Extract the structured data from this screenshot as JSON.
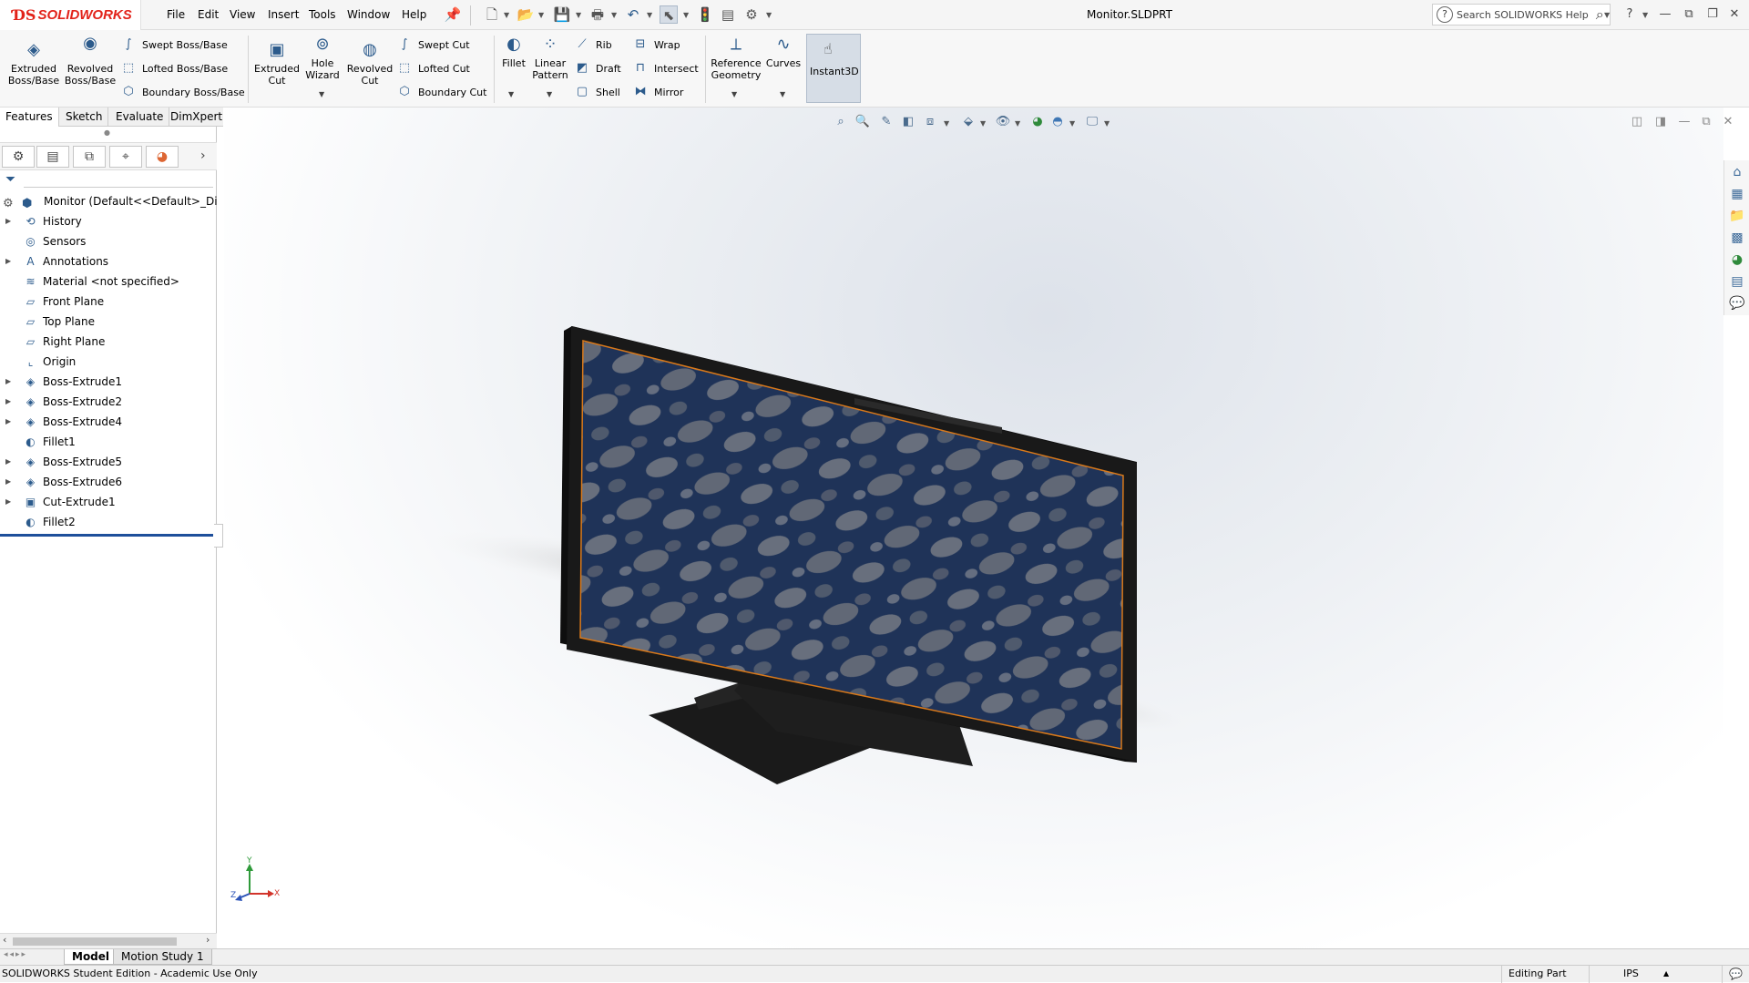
{
  "app": {
    "brand": "SOLIDWORKS",
    "document_title": "Monitor.SLDPRT"
  },
  "menu": [
    "File",
    "Edit",
    "View",
    "Insert",
    "Tools",
    "Window",
    "Help"
  ],
  "search": {
    "placeholder": "Search SOLIDWORKS Help"
  },
  "ribbon": {
    "extruded_boss": [
      "Extruded",
      "Boss/Base"
    ],
    "revolved_boss": [
      "Revolved",
      "Boss/Base"
    ],
    "swept_boss": "Swept Boss/Base",
    "lofted_boss": "Lofted Boss/Base",
    "boundary_boss": "Boundary Boss/Base",
    "extruded_cut": [
      "Extruded",
      "Cut"
    ],
    "hole_wizard": [
      "Hole",
      "Wizard"
    ],
    "revolved_cut": [
      "Revolved",
      "Cut"
    ],
    "swept_cut": "Swept Cut",
    "lofted_cut": "Lofted Cut",
    "boundary_cut": "Boundary Cut",
    "fillet": "Fillet",
    "linear_pattern": [
      "Linear",
      "Pattern"
    ],
    "rib": "Rib",
    "draft": "Draft",
    "shell": "Shell",
    "wrap": "Wrap",
    "intersect": "Intersect",
    "mirror": "Mirror",
    "reference_geometry": [
      "Reference",
      "Geometry"
    ],
    "curves": "Curves",
    "instant3d": "Instant3D"
  },
  "command_tabs": [
    "Features",
    "Sketch",
    "Evaluate",
    "DimXpert"
  ],
  "tree": {
    "root": "Monitor  (Default<<Default>_Displ",
    "items": [
      {
        "label": "History",
        "icon": "history-icon",
        "expandable": true
      },
      {
        "label": "Sensors",
        "icon": "sensors-icon",
        "expandable": false
      },
      {
        "label": "Annotations",
        "icon": "annotations-icon",
        "expandable": true
      },
      {
        "label": "Material <not specified>",
        "icon": "material-icon",
        "expandable": false
      },
      {
        "label": "Front Plane",
        "icon": "plane-icon",
        "expandable": false
      },
      {
        "label": "Top Plane",
        "icon": "plane-icon",
        "expandable": false
      },
      {
        "label": "Right Plane",
        "icon": "plane-icon",
        "expandable": false
      },
      {
        "label": "Origin",
        "icon": "origin-icon",
        "expandable": false
      },
      {
        "label": "Boss-Extrude1",
        "icon": "extrude-icon",
        "expandable": true
      },
      {
        "label": "Boss-Extrude2",
        "icon": "extrude-icon",
        "expandable": true
      },
      {
        "label": "Boss-Extrude4",
        "icon": "extrude-icon",
        "expandable": true
      },
      {
        "label": "Fillet1",
        "icon": "fillet-icon",
        "expandable": false
      },
      {
        "label": "Boss-Extrude5",
        "icon": "extrude-icon",
        "expandable": true
      },
      {
        "label": "Boss-Extrude6",
        "icon": "extrude-icon",
        "expandable": true
      },
      {
        "label": "Cut-Extrude1",
        "icon": "cut-icon",
        "expandable": true
      },
      {
        "label": "Fillet2",
        "icon": "fillet-icon",
        "expandable": false
      }
    ]
  },
  "bottom_tabs": [
    "Model",
    "Motion Study 1"
  ],
  "status": {
    "left": "SOLIDWORKS Student Edition - Academic Use Only",
    "mode": "Editing Part",
    "units": "IPS"
  },
  "triad": {
    "x": "X",
    "y": "Y",
    "z": "Z"
  },
  "colors": {
    "brand_red": "#e2231a",
    "accent_blue": "#2c5b8c",
    "bezel": "#1a1a1a",
    "screen_outline": "#d9791a",
    "screen": "#1d3256"
  }
}
